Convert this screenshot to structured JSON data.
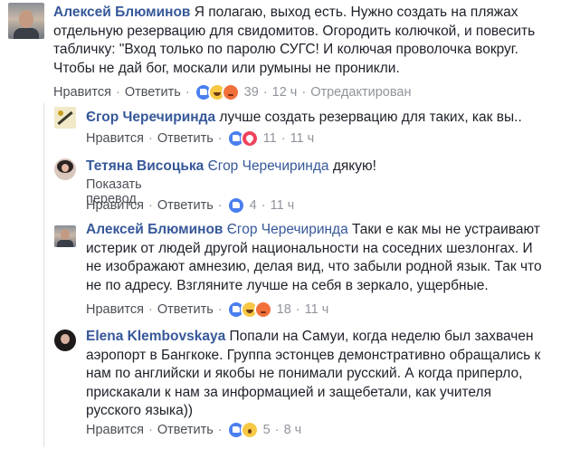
{
  "labels": {
    "like": "Нравится",
    "reply": "Ответить",
    "dot": "·",
    "translate": "Показать перевод"
  },
  "colors": {
    "link": "#365899",
    "meta": "#90949c",
    "text": "#1d2129"
  },
  "comments": [
    {
      "author": "Алексей Блюминов",
      "mention": "",
      "text": " Я полагаю, выход есть. Нужно создать на пляжах отдельную резервацию для свидомитов. Огородить колючкой, и повесить табличку: \"Вход только по паролю СУГС! И колючая проволочка вокруг. Чтобы не дай бог, москали или румыны не проникли.",
      "reactions": [
        "like-icon",
        "haha-icon",
        "angry-icon"
      ],
      "count": "39",
      "time": "12 ч",
      "edited": "Отредактирован"
    },
    {
      "author": "Єгор Черечиринда",
      "mention": "",
      "text": " лучше создать резервацию для таких, как вы..",
      "reactions": [
        "like-icon",
        "heart-icon"
      ],
      "count": "11",
      "time": "11 ч"
    },
    {
      "author": "Тетяна Висоцька",
      "mention": "Єгор Черечиринда",
      "text": " дякую!",
      "reactions": [
        "like-icon"
      ],
      "count": "4",
      "time": "11 ч"
    },
    {
      "author": "Алексей Блюминов",
      "mention": "Єгор Черечиринда",
      "text": " Таки е как мы не устраивают истерик от людей другой национальности на соседних шезлонгах. И не изображают амнезию, делая вид, что забыли родной язык. Так что не по адресу. Взгляните лучше на себя в зеркало, ущербные.",
      "reactions": [
        "like-icon",
        "haha-icon",
        "angry-icon"
      ],
      "count": "18",
      "time": "11 ч"
    },
    {
      "author": "Elena Klembovskaya",
      "mention": "",
      "text": " Попали на Самуи, когда неделю был захвачен аэропорт в Бангкоке. Группа эстонцев демонстративно обращались к нам по английски и якобы не понимали русский. А когда приперло, прискакали к нам за информацией и защебетали, как учителя русского языка))",
      "reactions": [
        "like-icon",
        "wow-icon"
      ],
      "count": "5",
      "time": "8 ч"
    }
  ]
}
